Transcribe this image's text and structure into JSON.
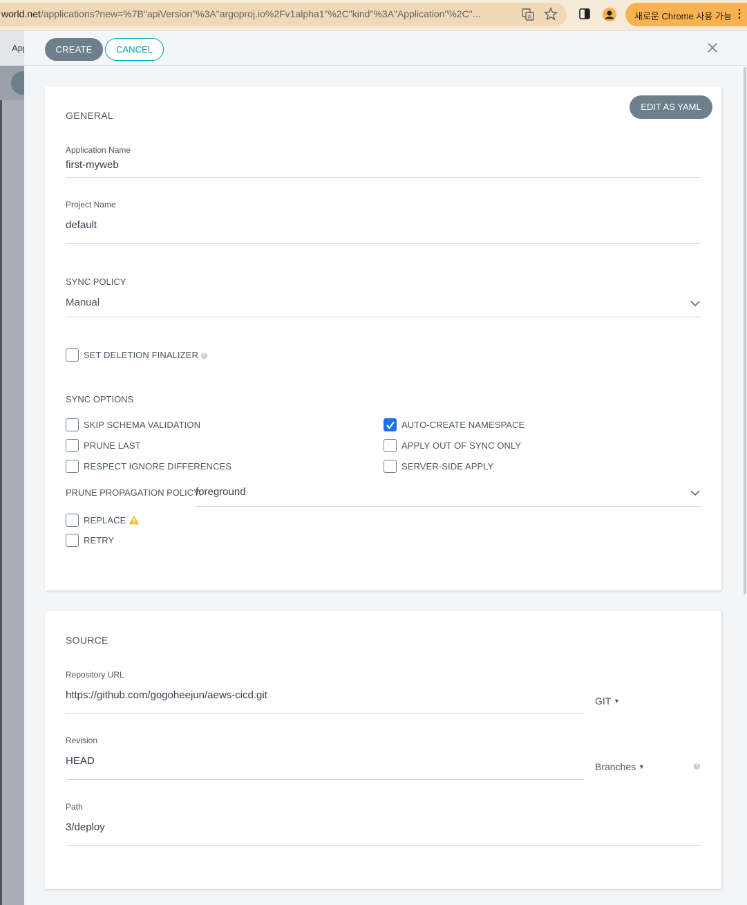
{
  "browser": {
    "url_host": "world.net",
    "url_path": "/applications?new=%7B\"apiVersion\"%3A\"argoproj.io%2Fv1alpha1\"%2C\"kind\"%3A\"Application\"%2C\"...",
    "promo_label": "새로운 Chrome 사용 가능"
  },
  "background": {
    "app_label": "App"
  },
  "toolbar": {
    "create_label": "CREATE",
    "cancel_label": "CANCEL"
  },
  "general": {
    "title": "GENERAL",
    "edit_yaml_label": "EDIT AS YAML",
    "app_name": {
      "label": "Application Name",
      "value": "first-myweb"
    },
    "project_name": {
      "label": "Project Name",
      "value": "default"
    },
    "sync_policy": {
      "label": "SYNC POLICY",
      "value": "Manual"
    },
    "deletion_finalizer": {
      "label": "SET DELETION FINALIZER",
      "checked": false
    },
    "sync_options": {
      "title": "SYNC OPTIONS",
      "left": [
        {
          "label": "SKIP SCHEMA VALIDATION",
          "checked": false
        },
        {
          "label": "PRUNE LAST",
          "checked": false
        },
        {
          "label": "RESPECT IGNORE DIFFERENCES",
          "checked": false
        }
      ],
      "right": [
        {
          "label": "AUTO-CREATE NAMESPACE",
          "checked": true
        },
        {
          "label": "APPLY OUT OF SYNC ONLY",
          "checked": false
        },
        {
          "label": "SERVER-SIDE APPLY",
          "checked": false
        }
      ]
    },
    "prune_policy": {
      "label": "PRUNE PROPAGATION POLICY:",
      "value": "foreground"
    },
    "replace": {
      "label": "REPLACE",
      "checked": false
    },
    "retry": {
      "label": "RETRY",
      "checked": false
    }
  },
  "source": {
    "title": "SOURCE",
    "repo_url": {
      "label": "Repository URL",
      "value": "https://github.com/gogoheejun/aews-cicd.git",
      "type": "GIT"
    },
    "revision": {
      "label": "Revision",
      "value": "HEAD",
      "type": "Branches"
    },
    "path": {
      "label": "Path",
      "value": "3/deploy"
    }
  },
  "colors": {
    "accent": "#00a2b3",
    "button": "#6d7f8b",
    "checkbox_checked": "#1a73e8",
    "warning": "#f4c030"
  }
}
